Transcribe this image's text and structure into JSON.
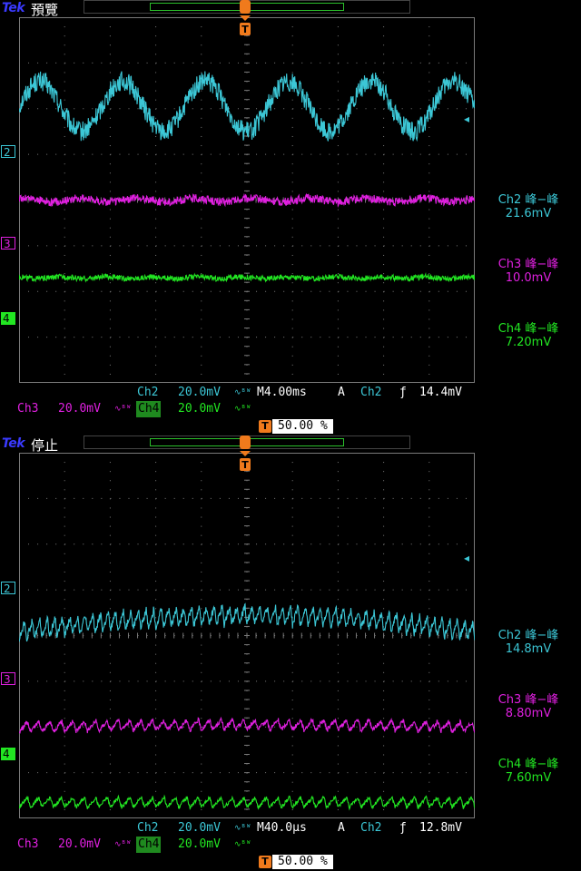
{
  "colors": {
    "ch2": "#3cc7d6",
    "ch3": "#e020e0",
    "ch4": "#22e622",
    "grid": "#7a7a7a",
    "accent": "#f07a1c"
  },
  "panels": [
    {
      "brand": "Tek",
      "status": "預覽",
      "markers": {
        "ch2": "2",
        "ch3": "3",
        "ch4": "4"
      },
      "measurements": [
        {
          "label": "Ch2 峰−峰",
          "value": "21.6mV"
        },
        {
          "label": "Ch3 峰−峰",
          "value": "10.0mV"
        },
        {
          "label": "Ch4 峰−峰",
          "value": "7.20mV"
        }
      ],
      "bar": {
        "ch2_label": "Ch2",
        "ch2_scale": "20.0mV",
        "ch3_label": "Ch3",
        "ch3_scale": "20.0mV",
        "ch4_label": "Ch4",
        "ch4_scale": "20.0mV",
        "timebase": "M4.00ms",
        "mode": "A",
        "trig_ch": "Ch2",
        "trig_level": "14.4mV",
        "trig_pos_icon": "T",
        "trig_pos": "50.00 %"
      }
    },
    {
      "brand": "Tek",
      "status": "停止",
      "markers": {
        "ch2": "2",
        "ch3": "3",
        "ch4": "4"
      },
      "measurements": [
        {
          "label": "Ch2 峰−峰",
          "value": "14.8mV"
        },
        {
          "label": "Ch3 峰−峰",
          "value": "8.80mV"
        },
        {
          "label": "Ch4 峰−峰",
          "value": "7.60mV"
        }
      ],
      "bar": {
        "ch2_label": "Ch2",
        "ch2_scale": "20.0mV",
        "ch3_label": "Ch3",
        "ch3_scale": "20.0mV",
        "ch4_label": "Ch4",
        "ch4_scale": "20.0mV",
        "timebase": "M40.0μs",
        "mode": "A",
        "trig_ch": "Ch2",
        "trig_level": "12.8mV",
        "trig_pos_icon": "T",
        "trig_pos": "50.00 %"
      }
    }
  ],
  "chart_data": [
    {
      "type": "line",
      "title": "",
      "x_divisions": 10,
      "y_divisions": 8,
      "series": [
        {
          "name": "Ch2",
          "color": "#3cc7d6",
          "offset_div": 2.05,
          "ripple_div": 0.55,
          "ripple_periods": 5.5,
          "noise_div": 0.22
        },
        {
          "name": "Ch3",
          "color": "#e020e0",
          "offset_div": 0.0,
          "ripple_div": 0.04,
          "ripple_periods": 8,
          "noise_div": 0.09
        },
        {
          "name": "Ch4",
          "color": "#22e622",
          "offset_div": -1.7,
          "ripple_div": 0.02,
          "ripple_periods": 10,
          "noise_div": 0.06
        }
      ]
    },
    {
      "type": "line",
      "title": "",
      "x_divisions": 10,
      "y_divisions": 8,
      "series": [
        {
          "name": "Ch2",
          "color": "#3cc7d6",
          "offset_div": 0.1,
          "ripple_div": 0.4,
          "ripple_periods": 60,
          "noise_div": 0.08,
          "bow_div": 0.35
        },
        {
          "name": "Ch3",
          "color": "#e020e0",
          "offset_div": -2.0,
          "ripple_div": 0.22,
          "ripple_periods": 40,
          "noise_div": 0.05,
          "bow_div": 0.05
        },
        {
          "name": "Ch4",
          "color": "#22e622",
          "offset_div": -3.65,
          "ripple_div": 0.22,
          "ripple_periods": 40,
          "noise_div": 0.04,
          "bow_div": 0.0
        }
      ]
    }
  ]
}
